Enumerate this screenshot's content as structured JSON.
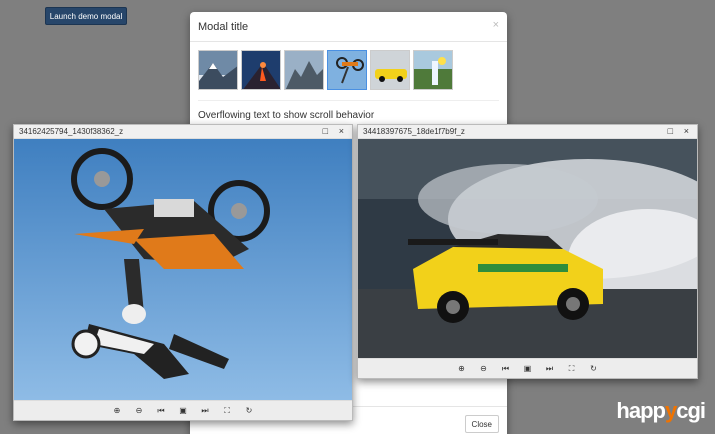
{
  "page": {
    "launch_label": "Launch demo modal"
  },
  "modal": {
    "title": "Modal title",
    "close_glyph": "×",
    "body_heading": "Overflowing text to show scroll behavior",
    "footer_close_label": "Close",
    "thumbnails": [
      "mountains-clouds",
      "volcano-lava",
      "rocky-peaks",
      "motocross-jump",
      "yellow-race-car",
      "waterfall-hills"
    ]
  },
  "viewer_left": {
    "title": "34162425794_1430f38362_z",
    "maximize_glyph": "□",
    "close_glyph": "×"
  },
  "viewer_right": {
    "title": "34418397675_18de1f7b9f_z",
    "maximize_glyph": "□",
    "close_glyph": "×"
  },
  "toolbar": {
    "zoom_in": "⊕",
    "zoom_out": "⊖",
    "prev": "⏮",
    "original": "▣",
    "next": "⏭",
    "fullscreen": "⛶",
    "rotate": "↻"
  },
  "watermark": {
    "brand": "happycgi",
    "brand_start": "happ",
    "brand_mid": "y",
    "brand_end": "cgi"
  }
}
